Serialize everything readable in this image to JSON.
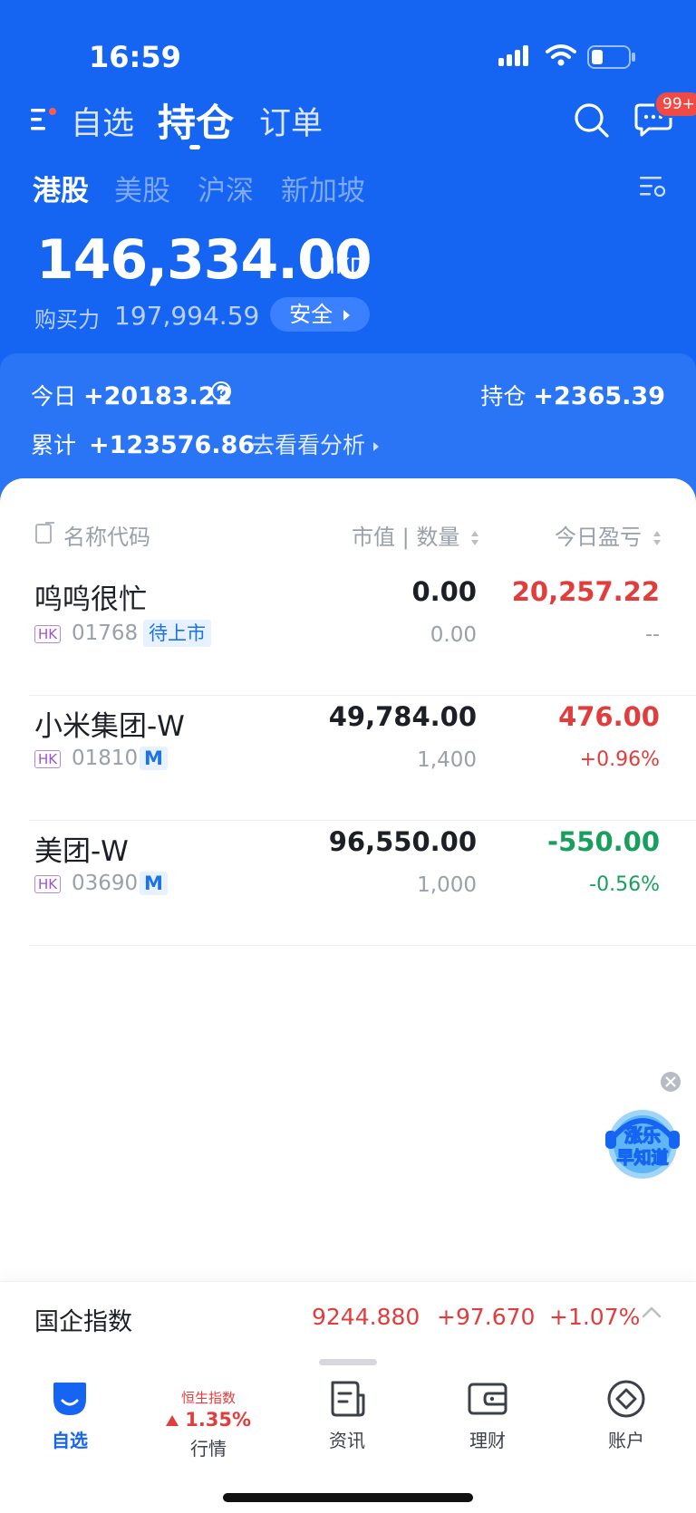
{
  "status_bar": {
    "time": "16:59"
  },
  "nav": {
    "tabs": [
      {
        "label": "自选",
        "active": false
      },
      {
        "label": "持仓",
        "active": true
      },
      {
        "label": "订单",
        "active": false
      }
    ],
    "message_badge": "99+"
  },
  "markets": [
    "港股",
    "美股",
    "沪深",
    "新加坡"
  ],
  "account": {
    "total_value": "146,334.00",
    "currency": "HKD",
    "buying_power_label": "购买力",
    "buying_power": "197,994.59",
    "safety_label": "安全"
  },
  "summary": {
    "today_label": "今日",
    "today_value": "+20183.22",
    "holding_label": "持仓",
    "holding_value": "+2365.39",
    "cumulative_label": "累计",
    "cumulative_value": "+123576.86",
    "analysis_link": "去看看分析"
  },
  "table": {
    "headers": {
      "name": "名称代码",
      "market_value": "市值 | 数量",
      "pnl": "今日盈亏"
    },
    "rows": [
      {
        "name": "鸣鸣很忙",
        "market": "HK",
        "code": "01768",
        "tag": "待上市",
        "market_value": "0.00",
        "quantity": "0.00",
        "pnl": "20,257.22",
        "pnl_pct": "--"
      },
      {
        "name": "小米集团-W",
        "market": "HK",
        "code": "01810",
        "tag": "M",
        "market_value": "49,784.00",
        "quantity": "1,400",
        "pnl": "476.00",
        "pnl_pct": "+0.96%"
      },
      {
        "name": "美团-W",
        "market": "HK",
        "code": "03690",
        "tag": "M",
        "market_value": "96,550.00",
        "quantity": "1,000",
        "pnl": "-550.00",
        "pnl_pct": "-0.56%"
      }
    ]
  },
  "promo": {
    "line1": "涨乐",
    "line2": "早知道"
  },
  "index_bar": {
    "name": "国企指数",
    "value": "9244.880",
    "change": "+97.670",
    "change_pct": "+1.07%"
  },
  "tabbar": {
    "items": [
      {
        "label": "自选",
        "active": true
      },
      {
        "label": "行情",
        "index_name": "恒生指数",
        "index_change": "1.35%"
      },
      {
        "label": "资讯"
      },
      {
        "label": "理财"
      },
      {
        "label": "账户"
      }
    ]
  },
  "colors": {
    "brand_blue": "#1565f2",
    "up_red": "#e23d3d",
    "down_green": "#17a05d"
  }
}
